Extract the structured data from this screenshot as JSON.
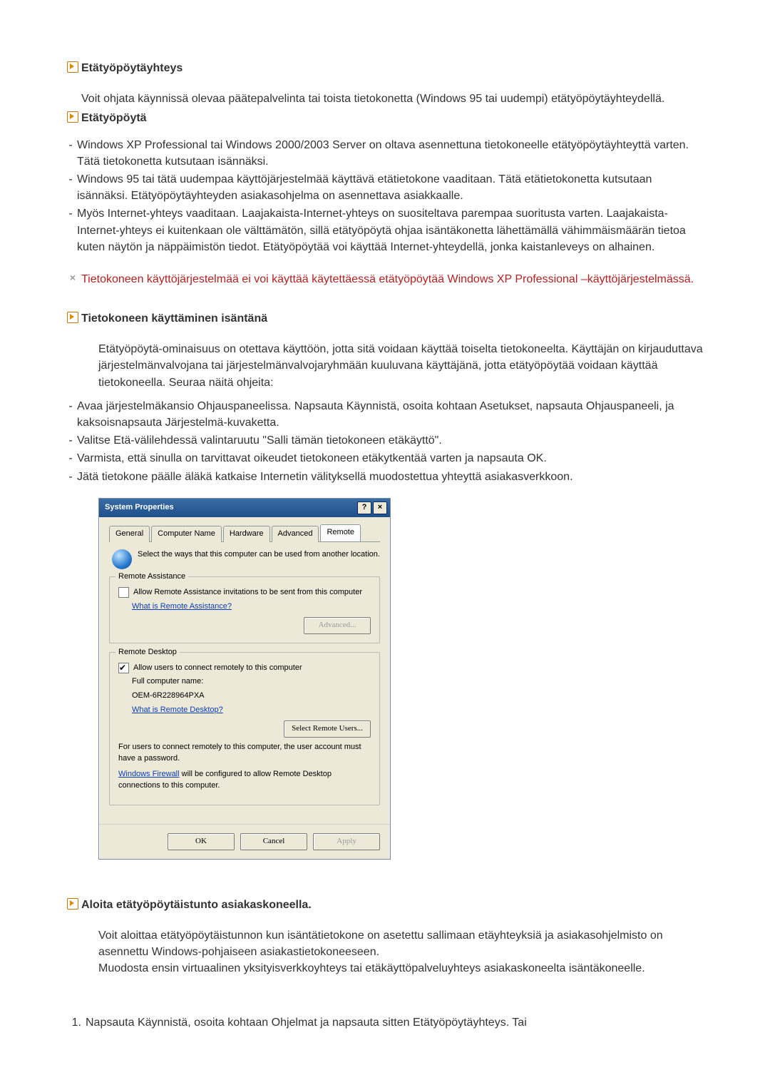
{
  "doc": {
    "h1": "Etätyöpöytäyhteys",
    "intro": "Voit ohjata käynnissä olevaa päätepalvelinta tai toista tietokonetta (Windows 95 tai uudempi) etätyöpöytäyhteydellä.",
    "s1": {
      "title": "Etätyöpöytä",
      "items": [
        "Windows XP Professional tai Windows 2000/2003 Server on oltava asennettuna tietokoneelle etätyöpöytäyhteyttä varten. Tätä tietokonetta kutsutaan isännäksi.",
        "Windows 95 tai tätä uudempaa käyttöjärjestelmää käyttävä etätietokone vaaditaan. Tätä etätietokonetta kutsutaan isännäksi. Etätyöpöytäyhteyden asiakasohjelma on asennettava asiakkaalle.",
        "Myös Internet-yhteys vaaditaan. Laajakaista-Internet-yhteys on suositeltava parempaa suoritusta varten. Laajakaista-Internet-yhteys ei kuitenkaan ole välttämätön, sillä etätyöpöytä ohjaa isäntäkonetta lähettämällä vähimmäismäärän tietoa kuten näytön ja näppäimistön tiedot. Etätyöpöytää voi käyttää Internet-yhteydellä, jonka kaistanleveys on alhainen."
      ]
    },
    "warn": "Tietokoneen käyttöjärjestelmää ei voi käyttää käytettäessä etätyöpöytää Windows XP Professional –käyttöjärjestelmässä.",
    "s2": {
      "title": "Tietokoneen käyttäminen isäntänä",
      "p": "Etätyöpöytä-ominaisuus on otettava käyttöön, jotta sitä voidaan käyttää toiselta tietokoneelta. Käyttäjän on kirjauduttava järjestelmänvalvojana tai järjestelmänvalvojaryhmään kuuluvana käyttäjänä, jotta etätyöpöytää voidaan käyttää tietokoneella. Seuraa näitä ohjeita:",
      "items": [
        "Avaa järjestelmäkansio Ohjauspaneelissa. Napsauta Käynnistä, osoita kohtaan Asetukset, napsauta Ohjauspaneeli, ja kaksoisnapsauta Järjestelmä-kuvaketta.",
        "Valitse Etä-välilehdessä valintaruutu \"Salli tämän tietokoneen etäkäyttö\".",
        "Varmista, että sinulla on tarvittavat oikeudet tietokoneen etäkytkentää varten ja napsauta OK.",
        "Jätä tietokone päälle äläkä katkaise Internetin välityksellä muodostettua yhteyttä asiakasverkkoon."
      ]
    },
    "s3": {
      "title": "Aloita etätyöpöytäistunto asiakaskoneella.",
      "p1": "Voit aloittaa etätyöpöytäistunnon kun isäntätietokone on asetettu sallimaan etäyhteyksiä ja asiakasohjelmisto on asennettu Windows-pohjaiseen asiakastietokoneeseen.",
      "p2": "Muodosta ensin virtuaalinen yksityisverkkoyhteys tai etäkäyttöpalveluyhteys asiakaskoneelta isäntäkoneelle."
    },
    "ol1": "Napsauta Käynnistä, osoita kohtaan Ohjelmat ja napsauta sitten Etätyöpöytäyhteys. Tai"
  },
  "dlg": {
    "title": "System Properties",
    "help_btn": "?",
    "close_btn": "×",
    "tabs": {
      "general": "General",
      "computer_name": "Computer Name",
      "hardware": "Hardware",
      "advanced": "Advanced",
      "remote": "Remote"
    },
    "header_text": "Select the ways that this computer can be used from another location.",
    "ra": {
      "legend": "Remote Assistance",
      "chk": "Allow Remote Assistance invitations to be sent from this computer",
      "link": "What is Remote Assistance?",
      "advanced_btn": "Advanced..."
    },
    "rd": {
      "legend": "Remote Desktop",
      "chk": "Allow users to connect remotely to this computer",
      "full_label": "Full computer name:",
      "full_value": "OEM-6R228964PXA",
      "link": "What is Remote Desktop?",
      "select_btn": "Select Remote Users...",
      "note": "For users to connect remotely to this computer, the user account must have a password.",
      "fw1": "Windows Firewall",
      "fw2": " will be configured to allow Remote Desktop connections to this computer."
    },
    "buttons": {
      "ok": "OK",
      "cancel": "Cancel",
      "apply": "Apply"
    }
  }
}
